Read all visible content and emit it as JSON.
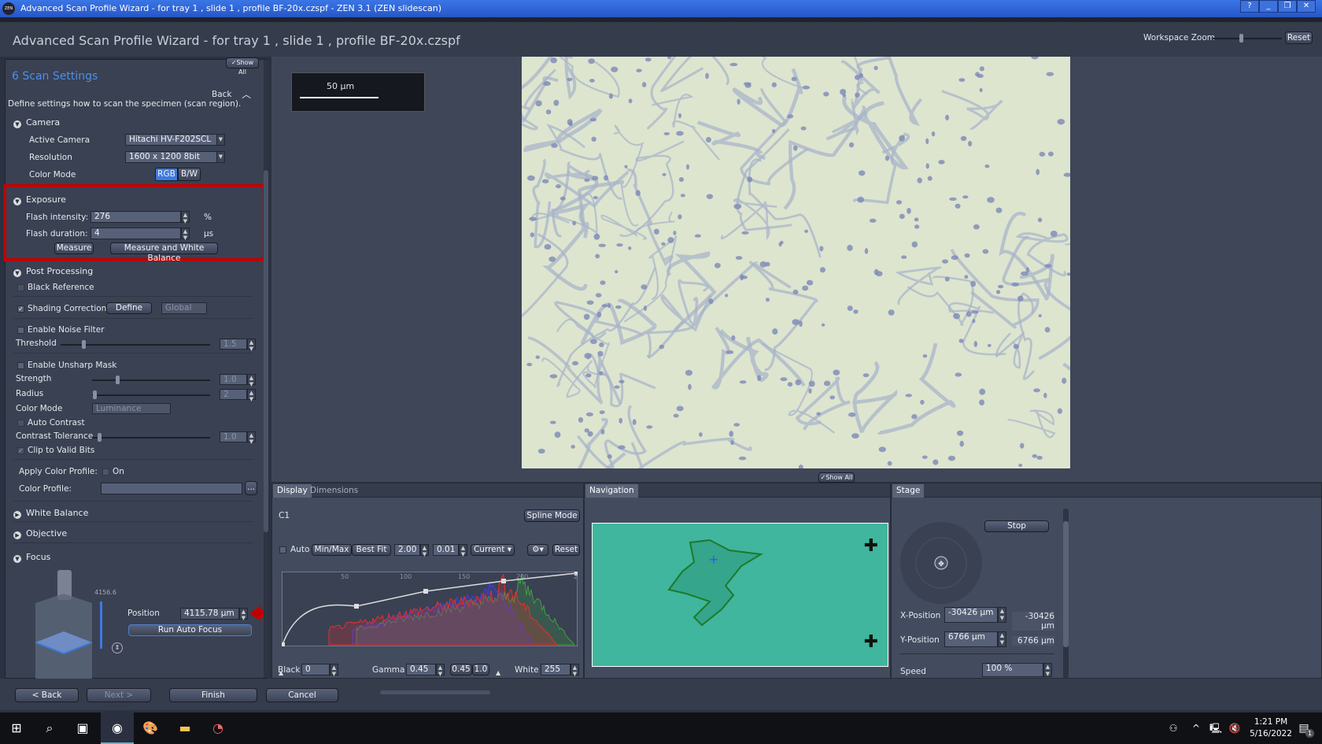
{
  "window": {
    "title": "Advanced Scan Profile Wizard -    for tray 1 , slide 1 , profile BF-20x.czspf      - ZEN 3.1 (ZEN slidescan)",
    "app_icon": "ZEN",
    "controls": [
      "?",
      "_",
      "❐",
      "✕"
    ]
  },
  "header": {
    "title": "Advanced Scan Profile Wizard -   for tray 1 , slide 1 , profile BF-20x.czspf",
    "workspace_zoom_label": "Workspace Zoom",
    "reset_label": "Reset"
  },
  "left": {
    "show_all": "✓Show All",
    "step_title": "6 Scan Settings",
    "back": "Back",
    "description": "Define settings how to scan the specimen (scan region).",
    "camera": {
      "title": "Camera",
      "active_camera_label": "Active Camera",
      "active_camera": "Hitachi HV-F202SCL",
      "resolution_label": "Resolution",
      "resolution": "1600 x 1200  8bit",
      "color_mode_label": "Color Mode",
      "rgb": "RGB",
      "bw": "B/W",
      "selected": "RGB"
    },
    "exposure": {
      "title": "Exposure",
      "flash_intensity_label": "Flash intensity:",
      "flash_intensity": "276",
      "flash_intensity_unit": "%",
      "flash_duration_label": "Flash duration:",
      "flash_duration": "4",
      "flash_duration_unit": "µs",
      "measure": "Measure",
      "measure_wb": "Measure and White Balance",
      "highlight_color": "#c00000"
    },
    "post": {
      "title": "Post Processing",
      "black_reference": "Black Reference",
      "shading_correction": "Shading Correction",
      "shading_checked": true,
      "define": "Define",
      "global": "Global",
      "noise_filter": "Enable Noise Filter",
      "threshold_label": "Threshold",
      "threshold": "1.5",
      "unsharp_mask": "Enable Unsharp Mask",
      "strength_label": "Strength",
      "strength": "1.0",
      "radius_label": "Radius",
      "radius": "2",
      "color_mode_label": "Color Mode",
      "color_mode": "Luminance",
      "auto_contrast": "Auto Contrast",
      "contrast_tolerance_label": "Contrast Tolerance",
      "contrast_tolerance": "1.0",
      "clip_valid_bits": "Clip to Valid Bits",
      "apply_color_profile_label": "Apply Color Profile:",
      "on": "On",
      "color_profile_label": "Color Profile:",
      "color_profile": "",
      "browse": "..."
    },
    "white_balance": "White Balance",
    "objective": "Objective",
    "focus": {
      "title": "Focus",
      "scale_top": "4156.6",
      "position_label": "Position",
      "position": "4115.78 µm",
      "run_auto_focus": "Run Auto Focus"
    }
  },
  "viewer": {
    "scale_bar": "50 µm",
    "show_all": "✓Show All"
  },
  "display": {
    "tabs": [
      "Display",
      "Dimensions"
    ],
    "channel": "C1",
    "spline_mode": "Spline Mode",
    "auto": "Auto",
    "minmax": "Min/Max",
    "best_fit": "Best Fit",
    "v1": "2.00",
    "v2": "0.01",
    "current": "Current",
    "reset": "Reset",
    "ticks": [
      "50",
      "100",
      "150",
      "200",
      "2"
    ],
    "black_label": "Black",
    "black": "0",
    "gamma_label": "Gamma",
    "gamma": "0.45",
    "g045": "0.45",
    "g10": "1.0",
    "white_label": "White",
    "white": "255"
  },
  "navigation": {
    "tab": "Navigation",
    "thumb_color": "#3fb69d"
  },
  "stage": {
    "tab": "Stage",
    "stop": "Stop",
    "x_label": "X-Position",
    "x": "-30426 µm",
    "x_read": "-30426 µm",
    "y_label": "Y-Position",
    "y": "6766 µm",
    "y_read": "6766 µm",
    "speed_label": "Speed",
    "speed": "100 %"
  },
  "footer": {
    "back": "< Back",
    "next": "Next >",
    "finish": "Finish",
    "cancel": "Cancel"
  },
  "taskbar": {
    "time": "1:21 PM",
    "date": "5/16/2022",
    "notifications": "1"
  }
}
